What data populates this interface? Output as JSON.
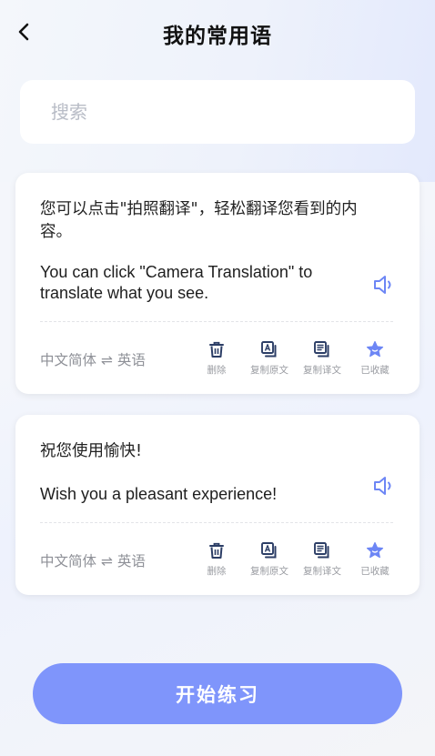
{
  "header": {
    "title": "我的常用语"
  },
  "search": {
    "placeholder": "搜索"
  },
  "phrases": [
    {
      "source": "您可以点击\"拍照翻译\"，轻松翻译您看到的内容。",
      "target": "You can click \"Camera Translation\" to translate what you see.",
      "lang_from": "中文简体",
      "lang_swap": "⇌",
      "lang_to": "英语",
      "actions": {
        "delete": "删除",
        "copy_source": "复制原文",
        "copy_translation": "复制译文",
        "favorited": "已收藏"
      }
    },
    {
      "source": "祝您使用愉快!",
      "target": "Wish you a pleasant experience!",
      "lang_from": "中文简体",
      "lang_swap": "⇌",
      "lang_to": "英语",
      "actions": {
        "delete": "删除",
        "copy_source": "复制原文",
        "copy_translation": "复制译文",
        "favorited": "已收藏"
      }
    }
  ],
  "footer": {
    "start_label": "开始练习"
  },
  "colors": {
    "accent": "#7f95fb",
    "icon_dark": "#2c3e66",
    "star": "#6d86f5"
  },
  "icons": [
    "back-arrow-icon",
    "speaker-icon",
    "trash-icon",
    "copy-source-icon",
    "copy-translation-icon",
    "star-icon"
  ]
}
